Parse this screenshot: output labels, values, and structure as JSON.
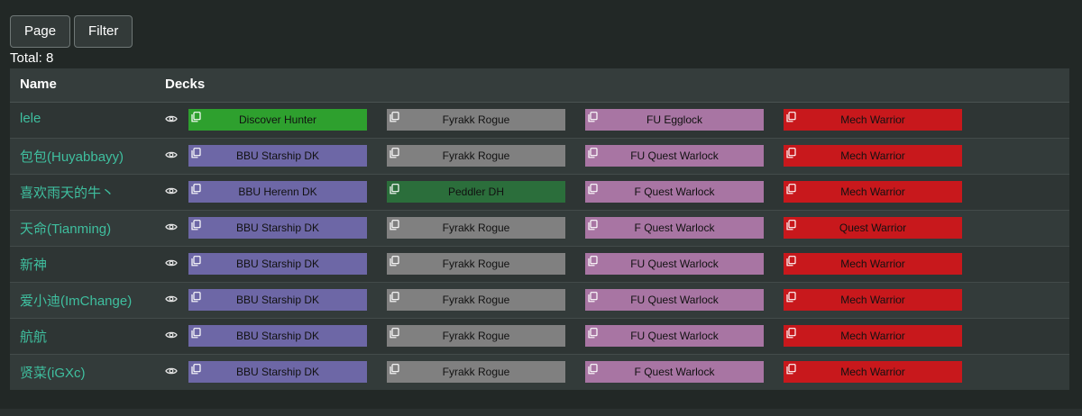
{
  "toolbar": {
    "page_label": "Page",
    "filter_label": "Filter"
  },
  "total_label": "Total: 8",
  "table": {
    "headers": {
      "name": "Name",
      "decks": "Decks"
    },
    "rows": [
      {
        "name": "lele",
        "decks": [
          {
            "label": "Discover Hunter",
            "color": "#2ea02e"
          },
          {
            "label": "Fyrakk Rogue",
            "color": "#808080"
          },
          {
            "label": "FU Egglock",
            "color": "#a875a3"
          },
          {
            "label": "Mech Warrior",
            "color": "#c8181c"
          }
        ]
      },
      {
        "name": "包包(Huyabbayy)",
        "decks": [
          {
            "label": "BBU Starship DK",
            "color": "#6d67a6"
          },
          {
            "label": "Fyrakk Rogue",
            "color": "#808080"
          },
          {
            "label": "FU Quest Warlock",
            "color": "#a875a3"
          },
          {
            "label": "Mech Warrior",
            "color": "#c8181c"
          }
        ]
      },
      {
        "name": "喜欢雨天的牛丶",
        "decks": [
          {
            "label": "BBU Herenn DK",
            "color": "#6d67a6"
          },
          {
            "label": "Peddler DH",
            "color": "#2b6e3b"
          },
          {
            "label": "F Quest Warlock",
            "color": "#a875a3"
          },
          {
            "label": "Mech Warrior",
            "color": "#c8181c"
          }
        ]
      },
      {
        "name": "天命(Tianming)",
        "decks": [
          {
            "label": "BBU Starship DK",
            "color": "#6d67a6"
          },
          {
            "label": "Fyrakk Rogue",
            "color": "#808080"
          },
          {
            "label": "F Quest Warlock",
            "color": "#a875a3"
          },
          {
            "label": "Quest Warrior",
            "color": "#c8181c"
          }
        ]
      },
      {
        "name": "新神",
        "decks": [
          {
            "label": "BBU Starship DK",
            "color": "#6d67a6"
          },
          {
            "label": "Fyrakk Rogue",
            "color": "#808080"
          },
          {
            "label": "FU Quest Warlock",
            "color": "#a875a3"
          },
          {
            "label": "Mech Warrior",
            "color": "#c8181c"
          }
        ]
      },
      {
        "name": "爱小迪(ImChange)",
        "decks": [
          {
            "label": "BBU Starship DK",
            "color": "#6d67a6"
          },
          {
            "label": "Fyrakk Rogue",
            "color": "#808080"
          },
          {
            "label": "FU Quest Warlock",
            "color": "#a875a3"
          },
          {
            "label": "Mech Warrior",
            "color": "#c8181c"
          }
        ]
      },
      {
        "name": "航航",
        "decks": [
          {
            "label": "BBU Starship DK",
            "color": "#6d67a6"
          },
          {
            "label": "Fyrakk Rogue",
            "color": "#808080"
          },
          {
            "label": "FU Quest Warlock",
            "color": "#a875a3"
          },
          {
            "label": "Mech Warrior",
            "color": "#c8181c"
          }
        ]
      },
      {
        "name": "贤菜(iGXc)",
        "decks": [
          {
            "label": "BBU Starship DK",
            "color": "#6d67a6"
          },
          {
            "label": "Fyrakk Rogue",
            "color": "#808080"
          },
          {
            "label": "F Quest Warlock",
            "color": "#a875a3"
          },
          {
            "label": "Mech Warrior",
            "color": "#c8181c"
          }
        ]
      }
    ]
  },
  "icons": {
    "view": "eye-icon",
    "copy": "copy-icon"
  }
}
